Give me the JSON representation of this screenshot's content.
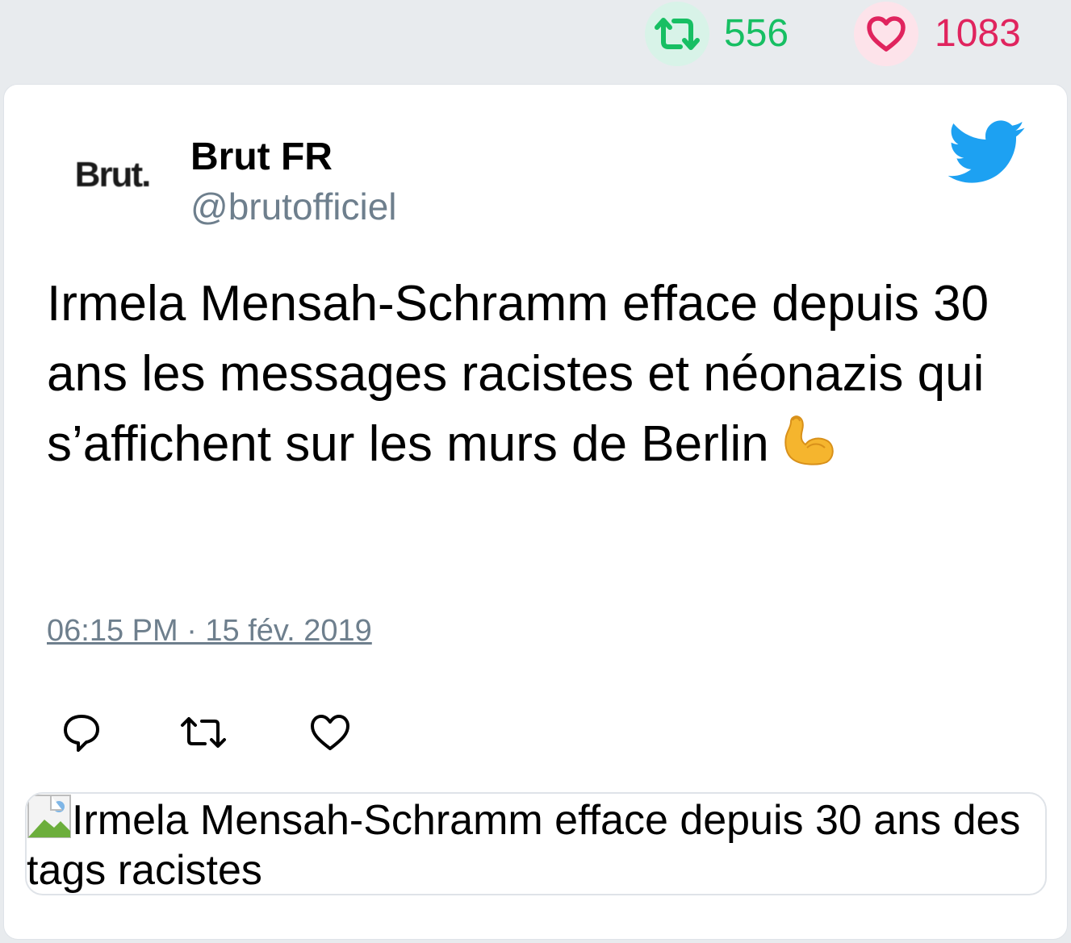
{
  "stats": {
    "retweets": {
      "icon": "retweet-icon",
      "count": "556",
      "color": "#17bf63"
    },
    "likes": {
      "icon": "heart-icon",
      "count": "1083",
      "color": "#e0245e"
    }
  },
  "tweet": {
    "author": {
      "name": "Brut FR",
      "handle": "@brutofficiel",
      "avatar_text": "Brut."
    },
    "brand_icon": "twitter-bird-icon",
    "text": "Irmela Mensah-Schramm efface depuis 30 ans les messages racistes et néonazis qui s’affichent sur les murs de Berlin",
    "emoji": "flexed-biceps-emoji",
    "timestamp": "06:15 PM · 15 fév. 2019",
    "actions": [
      "reply-icon",
      "retweet-icon",
      "like-icon"
    ],
    "media": {
      "alt": "Irmela Mensah-Schramm efface depuis 30 ans des tags racistes"
    }
  },
  "colors": {
    "accent": "#1da1f2",
    "muted": "#6e7f8d",
    "background": "#e8ebee"
  }
}
